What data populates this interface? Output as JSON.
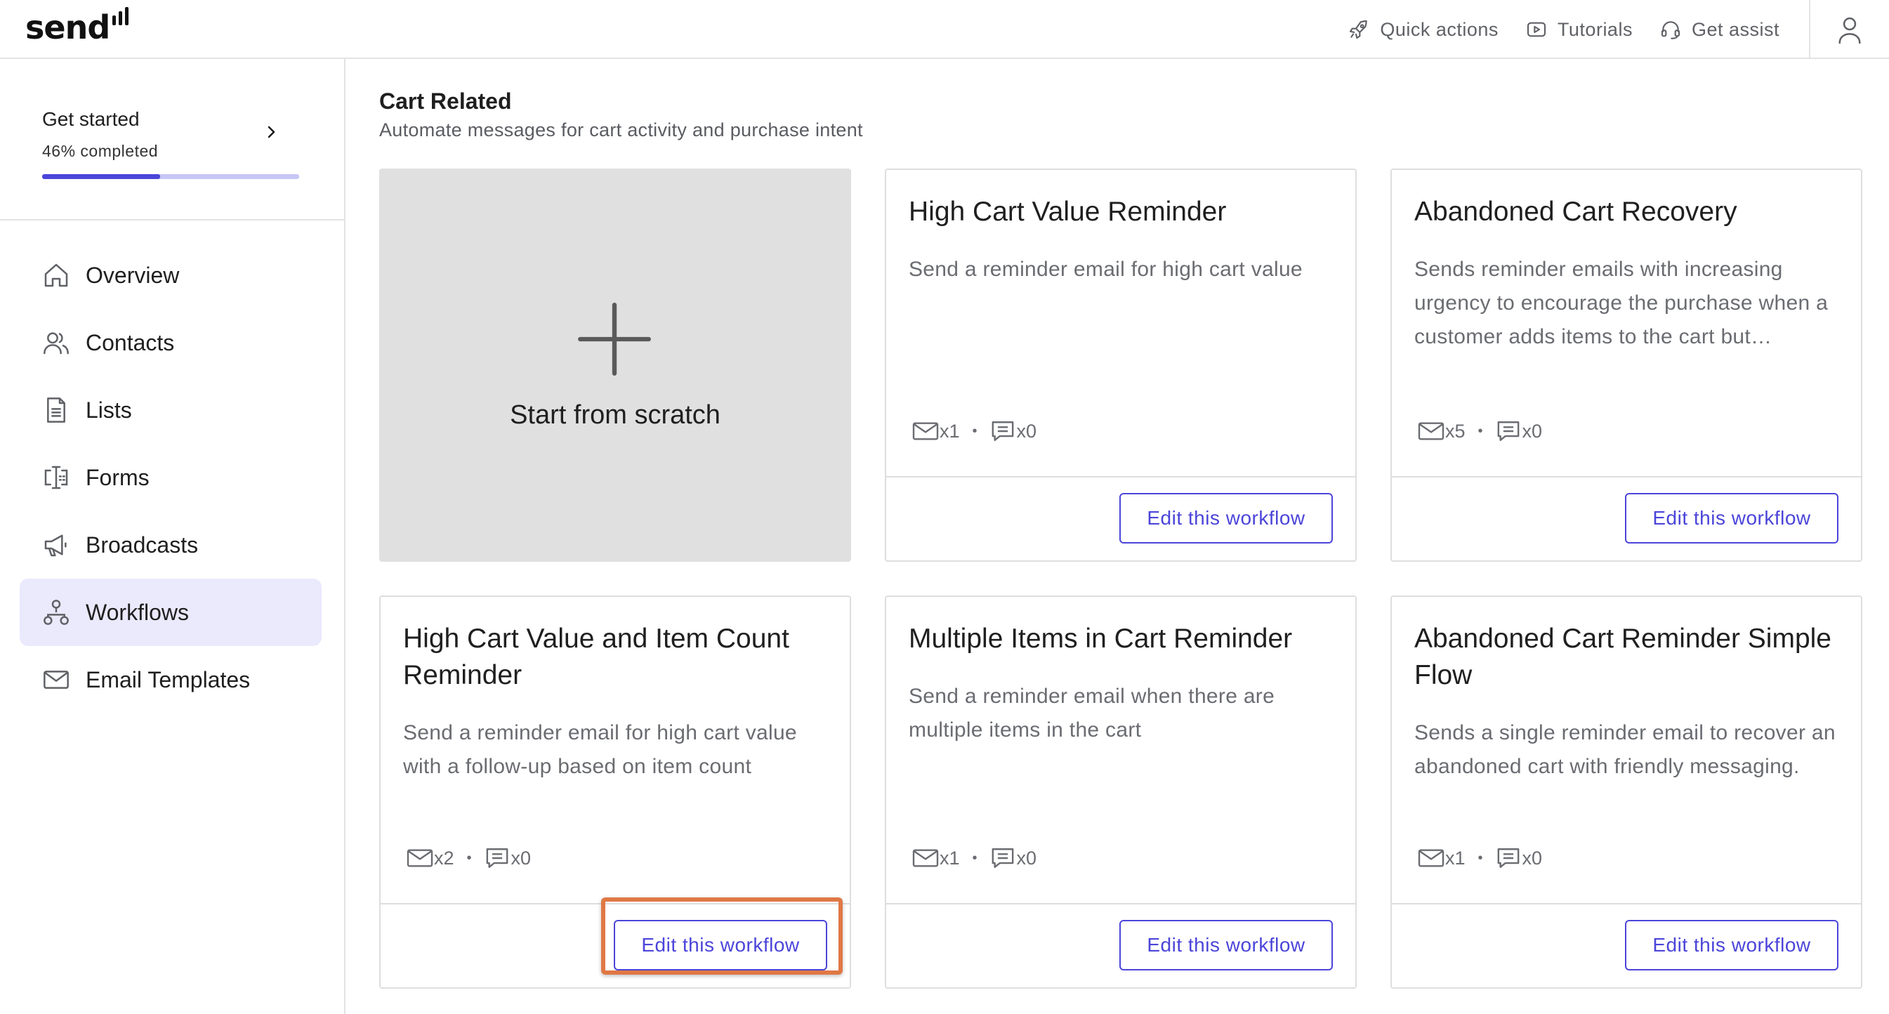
{
  "app": {
    "logo_text": "send",
    "top_actions": [
      {
        "label": "Quick actions",
        "icon": "rocket-icon"
      },
      {
        "label": "Tutorials",
        "icon": "play-icon"
      },
      {
        "label": "Get assist",
        "icon": "headset-icon"
      }
    ],
    "user_icon": "user-icon"
  },
  "colors": {
    "accent": "#4b45d9",
    "accent_light": "#ebe9fc",
    "progress_track": "#c8c6f6",
    "highlight": "#e07845"
  },
  "sidebar": {
    "get_started": {
      "title": "Get started",
      "progress_text": "46% completed",
      "progress": 0.46
    },
    "items": [
      {
        "label": "Overview",
        "icon": "home-icon",
        "active": false
      },
      {
        "label": "Contacts",
        "icon": "contacts-icon",
        "active": false
      },
      {
        "label": "Lists",
        "icon": "document-icon",
        "active": false
      },
      {
        "label": "Forms",
        "icon": "form-icon",
        "active": false
      },
      {
        "label": "Broadcasts",
        "icon": "megaphone-icon",
        "active": false
      },
      {
        "label": "Workflows",
        "icon": "workflow-icon",
        "active": true
      },
      {
        "label": "Email Templates",
        "icon": "mail-icon",
        "active": false
      }
    ]
  },
  "main": {
    "section_title": "Cart Related",
    "section_subtitle": "Automate messages for cart activity and purchase intent",
    "scratch_label": "Start from scratch",
    "cards": [
      {
        "title": "High Cart Value Reminder",
        "description": "Send a reminder email for high cart value",
        "emails": "x1",
        "messages": "x0",
        "button": "Edit this workflow"
      },
      {
        "title": "Abandoned Cart Recovery",
        "description": "Sends reminder emails with increasing urgency to encourage the purchase when a customer adds items to the cart but…",
        "emails": "x5",
        "messages": "x0",
        "button": "Edit this workflow"
      },
      {
        "title": "High Cart Value and Item Count Reminder",
        "description": "Send a reminder email for high cart value with a follow-up based on item count",
        "emails": "x2",
        "messages": "x0",
        "button": "Edit this workflow",
        "highlighted": true
      },
      {
        "title": "Multiple Items in Cart Reminder",
        "description": "Send a reminder email when there are multiple items in the cart",
        "emails": "x1",
        "messages": "x0",
        "button": "Edit this workflow"
      },
      {
        "title": "Abandoned Cart Reminder Simple Flow",
        "description": "Sends a single reminder email to recover an abandoned cart with friendly messaging.",
        "emails": "x1",
        "messages": "x0",
        "button": "Edit this workflow"
      }
    ]
  }
}
